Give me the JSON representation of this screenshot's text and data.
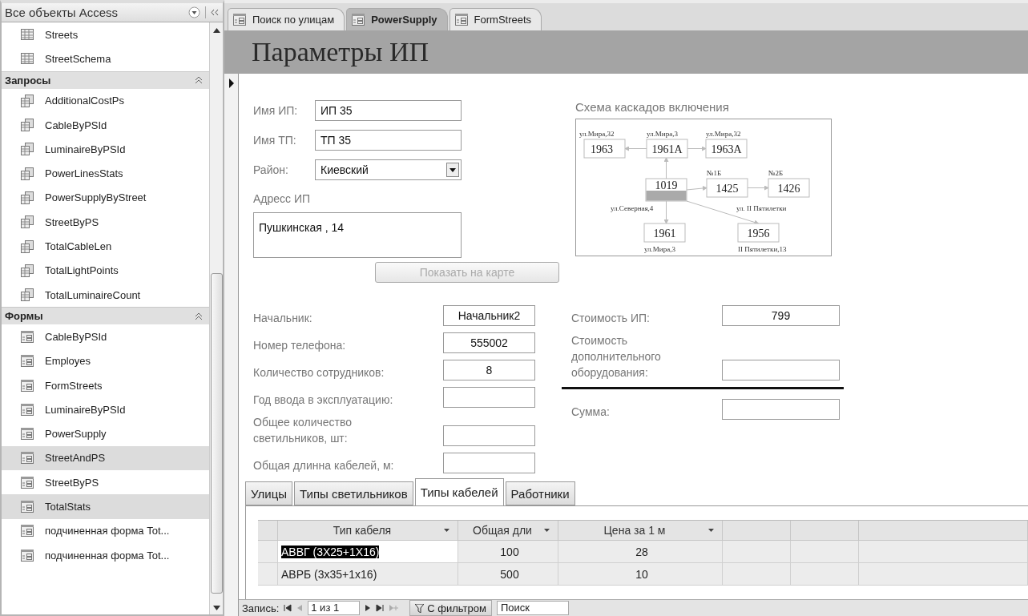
{
  "navigation_pane": {
    "title": "Все объекты Access",
    "groups": [
      {
        "kind": "table",
        "items": [
          {
            "label": "Streets",
            "selected": false
          },
          {
            "label": "StreetSchema",
            "selected": false
          }
        ]
      },
      {
        "kind": "query",
        "title": "Запросы",
        "items": [
          {
            "label": "AdditionalCostPs",
            "selected": false
          },
          {
            "label": "CableByPSId",
            "selected": false
          },
          {
            "label": "LuminaireByPSId",
            "selected": false
          },
          {
            "label": "PowerLinesStats",
            "selected": false
          },
          {
            "label": "PowerSupplyByStreet",
            "selected": false
          },
          {
            "label": "StreetByPS",
            "selected": false
          },
          {
            "label": "TotalCableLen",
            "selected": false
          },
          {
            "label": "TotalLightPoints",
            "selected": false
          },
          {
            "label": "TotalLuminaireCount",
            "selected": false
          }
        ]
      },
      {
        "kind": "form",
        "title": "Формы",
        "items": [
          {
            "label": "CableByPSId",
            "selected": false
          },
          {
            "label": "Employes",
            "selected": false
          },
          {
            "label": "FormStreets",
            "selected": false
          },
          {
            "label": "LuminaireByPSId",
            "selected": false
          },
          {
            "label": "PowerSupply",
            "selected": false
          },
          {
            "label": "StreetAndPS",
            "selected": true
          },
          {
            "label": "StreetByPS",
            "selected": false
          },
          {
            "label": "TotalStats",
            "selected": true
          },
          {
            "label": "подчиненная форма Tot...",
            "selected": false
          },
          {
            "label": "подчиненная форма Tot...",
            "selected": false
          }
        ]
      }
    ]
  },
  "document_tabs": [
    {
      "label": "Поиск по улицам",
      "selected": false
    },
    {
      "label": "PowerSupply",
      "selected": true
    },
    {
      "label": "FormStreets",
      "selected": false
    }
  ],
  "form": {
    "title": "Параметры ИП",
    "top_fields": [
      {
        "kind": "text",
        "label": "Имя ИП:",
        "value": "ИП 35"
      },
      {
        "kind": "text",
        "label": "Имя ТП:",
        "value": "ТП 35"
      },
      {
        "kind": "combo",
        "label": "Район:",
        "value": "Киевский"
      }
    ],
    "address": {
      "label": "Адресс ИП",
      "value": "Пушкинская , 14"
    },
    "map_button": {
      "label": "Показать на карте",
      "disabled": true
    },
    "scheme": {
      "title": "Схема каскадов включения",
      "nodes": [
        {
          "number": "1963",
          "caption": "ул.Мира,32",
          "highlighted": false
        },
        {
          "number": "1961A",
          "caption": "ул.Мира,3",
          "highlighted": false
        },
        {
          "number": "1963A",
          "caption": "ул.Мира,32",
          "highlighted": false
        },
        {
          "number": "1019",
          "caption": "ул.Северная,4",
          "highlighted": true
        },
        {
          "number": "1425",
          "caption": "№1Б",
          "highlighted": false
        },
        {
          "number": "1426",
          "caption": "№2Б",
          "highlighted": false
        },
        {
          "number": "1961",
          "caption": "ул.Мира,3",
          "highlighted": false
        },
        {
          "number": "1956",
          "caption": "II Пятилетки,13",
          "highlighted": false
        }
      ],
      "street_label": "ул. II Пятилетки"
    },
    "left_fields": [
      {
        "label": "Начальник:",
        "value": "Начальник2"
      },
      {
        "label": "Номер телефона:",
        "value": "555002"
      },
      {
        "label": "Количество сотрудников:",
        "value": "8"
      },
      {
        "label": "Год ввода в эксплуатацию:"
      },
      {
        "label": "Общее количество светильников, шт:"
      },
      {
        "label": "Общая длинна кабелей, м:"
      }
    ],
    "right_fields": [
      {
        "label": "Стоимость ИП:",
        "value": "799",
        "total": false
      },
      {
        "label": "Стоимость дополнительного оборудования:",
        "total": false
      },
      {
        "label": "Сумма:",
        "total": true
      }
    ],
    "subform_tabs": [
      {
        "label": "Улицы",
        "selected": false
      },
      {
        "label": "Типы светильников",
        "selected": false
      },
      {
        "label": "Типы кабелей",
        "selected": true
      },
      {
        "label": "Работники",
        "selected": false
      }
    ],
    "datasheet": {
      "columns": [
        "Тип кабеля",
        "Общая дли",
        "Цена за 1 м"
      ],
      "rows": [
        {
          "cells": [
            "АВВГ (3Х25+1Х16)",
            "100",
            "28"
          ],
          "selected": true
        },
        {
          "cells": [
            "АВРБ (3х35+1х16)",
            "500",
            "10"
          ],
          "selected": false
        }
      ]
    }
  },
  "status_bar": {
    "record_label": "Запись:",
    "position": "1 из 1",
    "filter": "С фильтром",
    "search": "Поиск"
  }
}
